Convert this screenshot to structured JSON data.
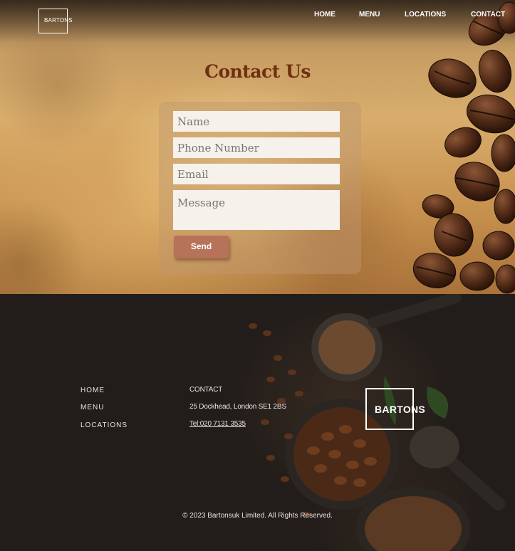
{
  "brand": {
    "logo_text": "BARTONS"
  },
  "nav": {
    "items": [
      "HOME",
      "MENU",
      "LOCATIONS",
      "CONTACT"
    ]
  },
  "contact": {
    "title": "Contact Us",
    "fields": {
      "name_placeholder": "Name",
      "phone_placeholder": "Phone Number",
      "email_placeholder": "Email",
      "message_placeholder": "Message"
    },
    "send_label": "Send"
  },
  "footer": {
    "links": [
      "HOME",
      "MENU",
      "LOCATIONS"
    ],
    "contact_heading": "CONTACT",
    "address": "25 Dockhead, London SE1 2BS",
    "phone": "Tel:020 7131 3535",
    "logo_text": "BARTONS",
    "copyright": "© 2023 Bartonsuk Limited. All Rights Reserved."
  },
  "colors": {
    "title": "#6e2f12",
    "send_button": "#b7725a",
    "footer_bg": "#221d1a"
  },
  "icons": [
    "coffee-beans-image",
    "coffee-cup-image"
  ]
}
